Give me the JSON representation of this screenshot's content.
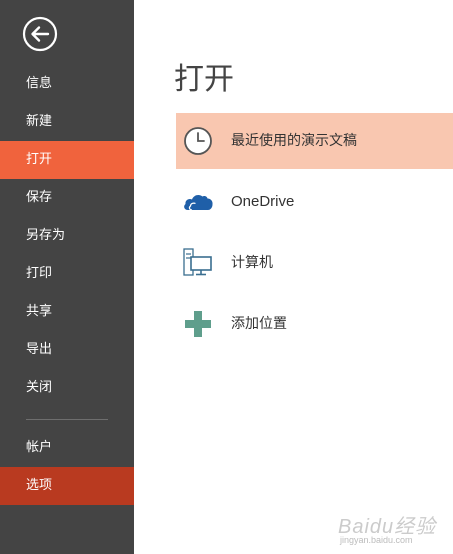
{
  "sidebar": {
    "back": {
      "icon": "back-arrow-icon"
    },
    "items": [
      {
        "label": "信息"
      },
      {
        "label": "新建"
      },
      {
        "label": "打开"
      },
      {
        "label": "保存"
      },
      {
        "label": "另存为"
      },
      {
        "label": "打印"
      },
      {
        "label": "共享"
      },
      {
        "label": "导出"
      },
      {
        "label": "关闭"
      },
      {
        "label": "帐户"
      },
      {
        "label": "选项"
      }
    ]
  },
  "main": {
    "title": "打开",
    "places": [
      {
        "label": "最近使用的演示文稿",
        "icon": "clock-icon"
      },
      {
        "label": "OneDrive",
        "icon": "onedrive-cloud-icon"
      },
      {
        "label": "计算机",
        "icon": "computer-icon"
      },
      {
        "label": "添加位置",
        "icon": "plus-icon"
      }
    ]
  },
  "watermark": {
    "text": "Baidu经验",
    "url": "jingyan.baidu.com"
  },
  "colors": {
    "sidebar_bg": "#444444",
    "active_item": "#f0633d",
    "options_item": "#b93a20",
    "selected_place": "#f9c7b0",
    "onedrive_blue": "#1f5fa8",
    "plus_green": "#5f9e8c"
  }
}
